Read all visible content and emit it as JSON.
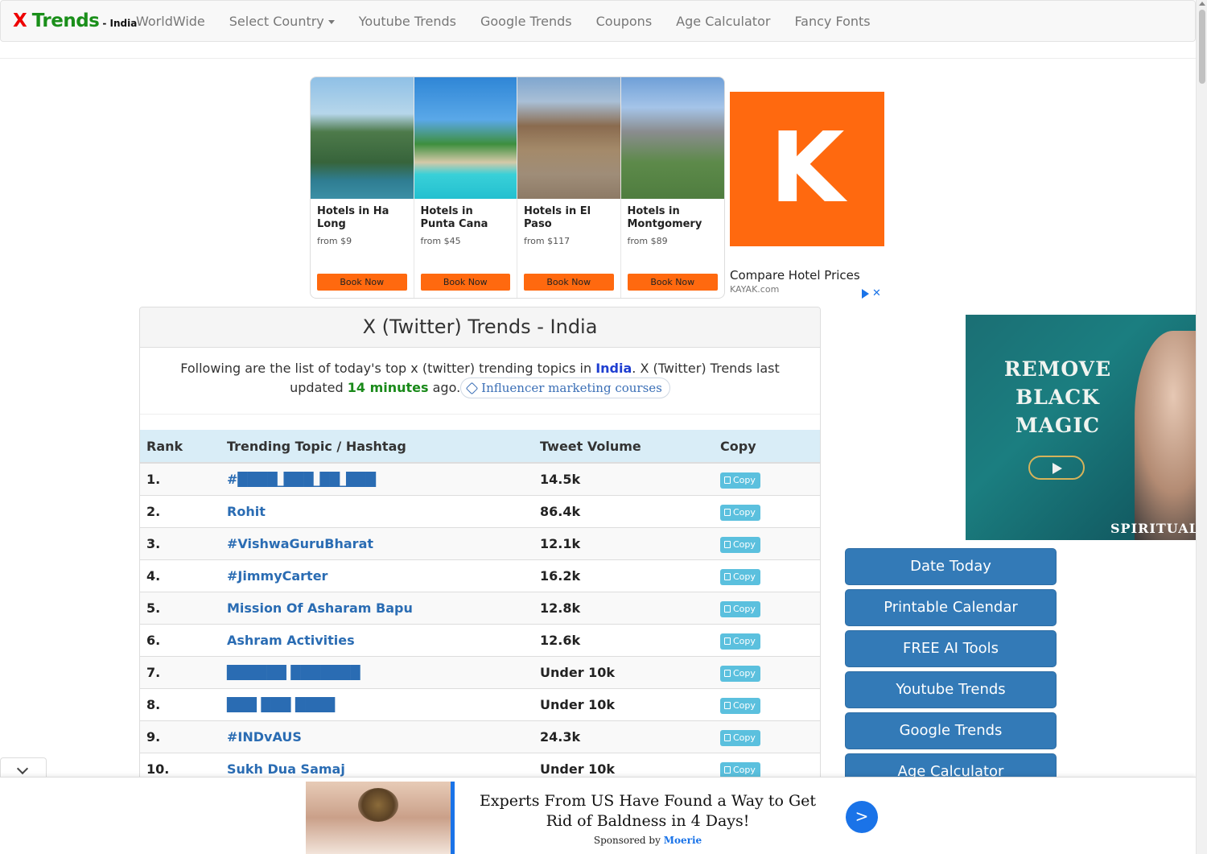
{
  "nav": {
    "brand_x": "X",
    "brand_trends": "Trends",
    "brand_suffix": "- India",
    "items": [
      "WorldWide",
      "Select Country",
      "Youtube Trends",
      "Google Trends",
      "Coupons",
      "Age Calculator",
      "Fancy Fonts"
    ]
  },
  "ad_top": {
    "hotels": [
      {
        "name": "Hotels in Ha Long",
        "price": "from $9",
        "button": "Book Now"
      },
      {
        "name": "Hotels in Punta Cana",
        "price": "from $45",
        "button": "Book Now"
      },
      {
        "name": "Hotels in El Paso",
        "price": "from $117",
        "button": "Book Now"
      },
      {
        "name": "Hotels in Montgomery",
        "price": "from $89",
        "button": "Book Now"
      }
    ],
    "logo_letter": "K",
    "title": "Compare Hotel Prices",
    "domain": "KAYAK.com",
    "close": "✕"
  },
  "panel": {
    "title": "X (Twitter) Trends - India",
    "intro_before": "Following are the list of today's top x (twitter) trending topics in ",
    "intro_country": "India",
    "intro_middle": ". X (Twitter) Trends last updated ",
    "intro_time": "14 minutes",
    "intro_after": " ago.",
    "pill": "Influencer marketing courses"
  },
  "table": {
    "headers": [
      "Rank",
      "Trending Topic / Hashtag",
      "Tweet Volume",
      "Copy"
    ],
    "copy_label": "Copy",
    "rows": [
      {
        "rank": "1.",
        "topic": "#████_███_██_███",
        "volume": "14.5k"
      },
      {
        "rank": "2.",
        "topic": "Rohit",
        "volume": "86.4k"
      },
      {
        "rank": "3.",
        "topic": "#VishwaGuruBharat",
        "volume": "12.1k"
      },
      {
        "rank": "4.",
        "topic": "#JimmyCarter",
        "volume": "16.2k"
      },
      {
        "rank": "5.",
        "topic": "Mission Of Asharam Bapu",
        "volume": "12.8k"
      },
      {
        "rank": "6.",
        "topic": "Ashram Activities",
        "volume": "12.6k"
      },
      {
        "rank": "7.",
        "topic": "██████ ███████",
        "volume": "Under 10k"
      },
      {
        "rank": "8.",
        "topic": "███ ███ ████",
        "volume": "Under 10k"
      },
      {
        "rank": "9.",
        "topic": "#INDvAUS",
        "volume": "24.3k"
      },
      {
        "rank": "10.",
        "topic": "Sukh Dua Samaj",
        "volume": "Under 10k"
      }
    ]
  },
  "ad_right": {
    "headline": "REMOVE BLACK MAGIC",
    "footer": "SPIRITUAL"
  },
  "side_buttons": [
    "Date Today",
    "Printable Calendar",
    "FREE AI Tools",
    "Youtube Trends",
    "Google Trends",
    "Age Calculator"
  ],
  "bottom_ad": {
    "text": "Experts From US Have Found a Way to Get Rid of Baldness in 4 Days!",
    "sponsored_by": "Sponsored by",
    "sponsor": "Moerie",
    "go": ">"
  },
  "colors": {
    "brand_red": "#ee0000",
    "brand_green": "#1a8f1a",
    "link_blue": "#2a6cb3",
    "side_button_blue": "#337ab7",
    "kayak_orange": "#ff690f",
    "copy_button": "#5bc0de",
    "table_header_bg": "#d9edf7"
  }
}
